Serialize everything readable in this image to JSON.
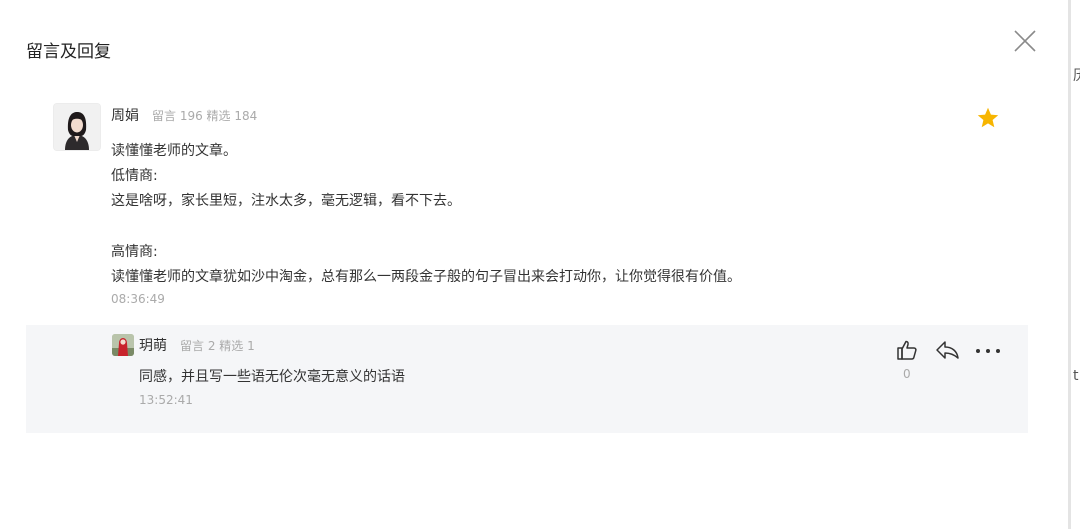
{
  "dialog": {
    "title": "留言及回复"
  },
  "comment": {
    "author": "周娟",
    "stats": "留言 196 精选 184",
    "lines": [
      "读懂懂老师的文章。",
      "低情商:",
      "这是啥呀，家长里短，注水太多，毫无逻辑，看不下去。",
      "",
      "高情商:",
      "读懂懂老师的文章犹如沙中淘金，总有那么一两段金子般的句子冒出来会打动你，让你觉得很有价值。"
    ],
    "time": "08:36:49",
    "star_color": "#f7b500"
  },
  "reply": {
    "author": "玥萌",
    "stats": "留言 2 精选 1",
    "text": "同感，并且写一些语无伦次毫无意义的话语",
    "time": "13:52:41",
    "like_count": "0"
  },
  "right_strip": {
    "chars": [
      "历",
      "t"
    ]
  },
  "icons": {
    "close": "close-icon",
    "star": "star-icon",
    "like": "thumbs-up-icon",
    "reply": "reply-icon",
    "more": "more-icon"
  }
}
